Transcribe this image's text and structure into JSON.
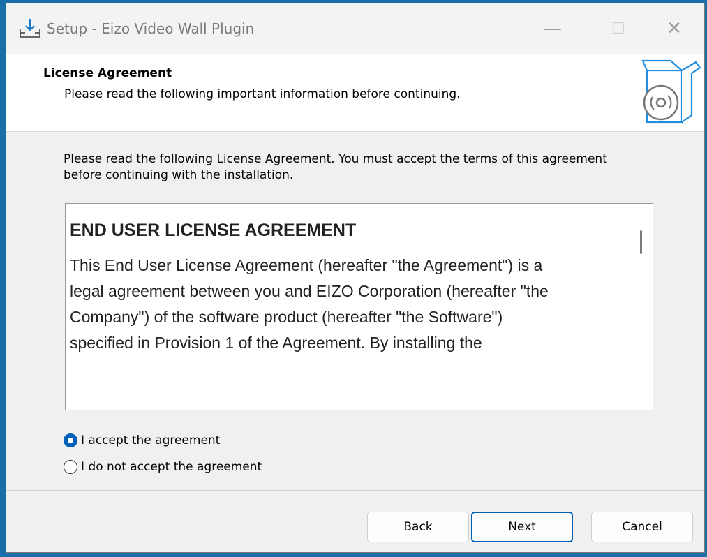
{
  "window": {
    "title": "Setup - Eizo Video Wall Plugin",
    "controls": {
      "minimize": "—",
      "maximize": "☐",
      "close": "✕"
    }
  },
  "header": {
    "title": "License Agreement",
    "subtitle": "Please read the following important information before continuing."
  },
  "body": {
    "intro": "Please read the following License Agreement. You must accept the terms of this agreement before continuing with the installation.",
    "license": {
      "heading": "END USER LICENSE AGREEMENT",
      "paragraph": "This End User License Agreement (hereafter \"the Agreement\") is a legal agreement between you and EIZO Corporation (hereafter \"the Company\") of the software product (hereafter \"the Software\") specified in Provision 1 of the Agreement. By installing the"
    },
    "options": [
      {
        "label": "I accept the agreement",
        "selected": true
      },
      {
        "label": "I do not accept the agreement",
        "selected": false
      }
    ]
  },
  "footer": {
    "back_label": "Back",
    "next_label": "Next",
    "cancel_label": "Cancel"
  },
  "colors": {
    "accent": "#005fb8",
    "desktop": "#1b6fa8",
    "dialog_bg": "#f0f0f0"
  },
  "icons": {
    "title": "install-download-icon",
    "header": "software-box-disc-icon"
  }
}
